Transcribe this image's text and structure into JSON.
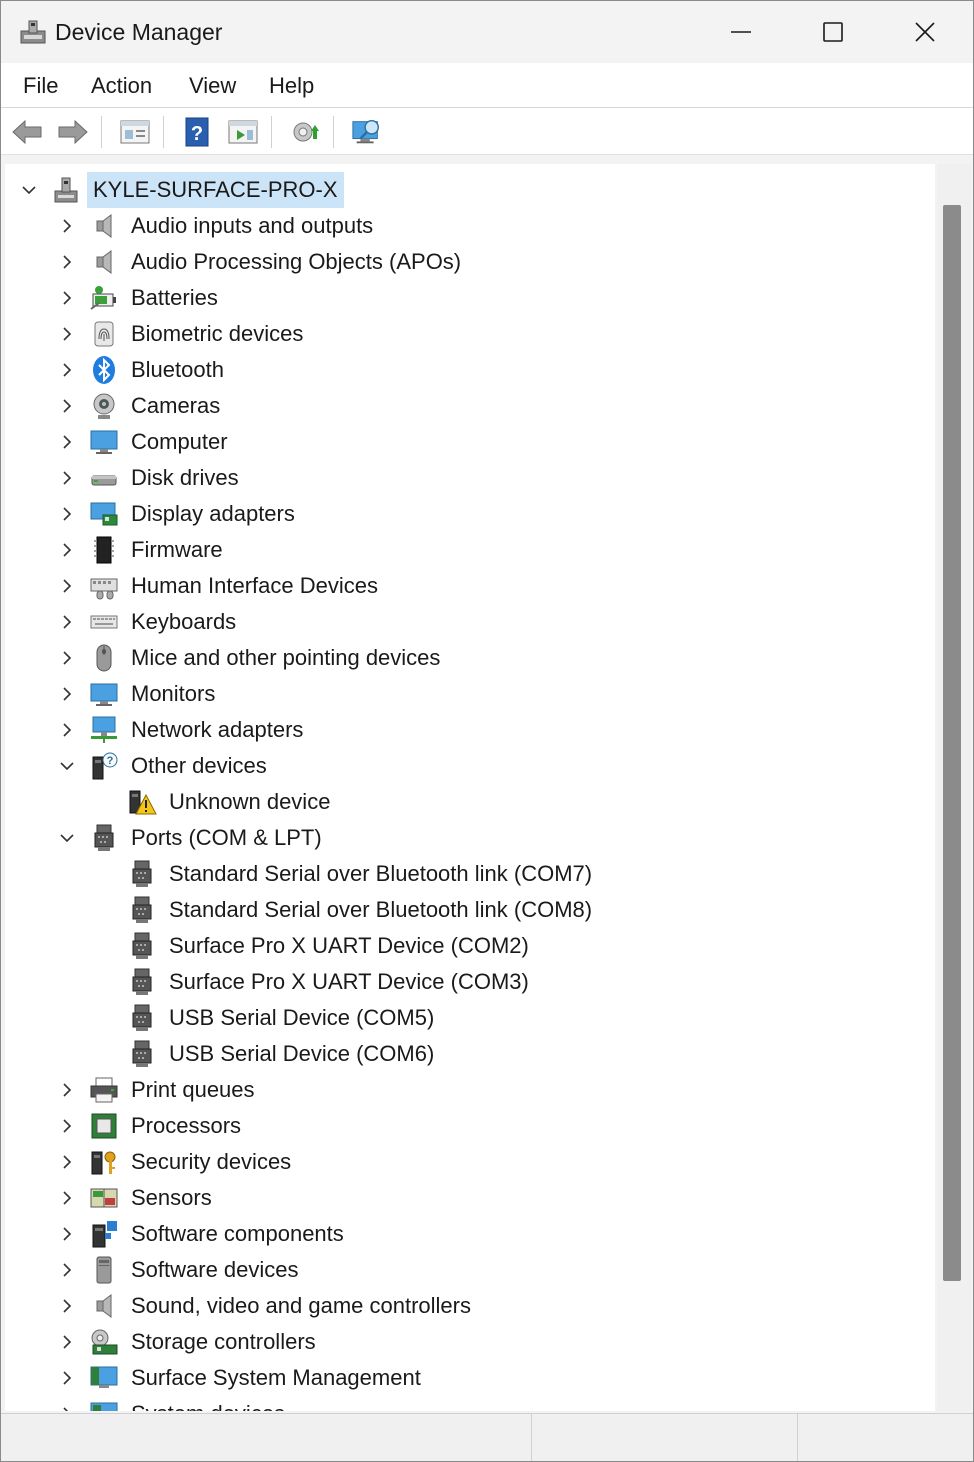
{
  "window": {
    "title": "Device Manager",
    "controls": [
      "minimize",
      "maximize",
      "close"
    ]
  },
  "menu": [
    "File",
    "Action",
    "View",
    "Help"
  ],
  "toolbar_icons": [
    "back-icon",
    "forward-icon",
    "properties-icon",
    "help-icon",
    "update-driver-icon",
    "add-hardware-icon",
    "scan-hardware-icon"
  ],
  "tree": {
    "root": {
      "label": "KYLE-SURFACE-PRO-X",
      "expanded": true
    },
    "categories": [
      {
        "label": "Audio inputs and outputs",
        "icon": "speaker-icon",
        "expanded": false
      },
      {
        "label": "Audio Processing Objects (APOs)",
        "icon": "speaker-icon",
        "expanded": false
      },
      {
        "label": "Batteries",
        "icon": "battery-icon",
        "expanded": false
      },
      {
        "label": "Biometric devices",
        "icon": "fingerprint-icon",
        "expanded": false
      },
      {
        "label": "Bluetooth",
        "icon": "bluetooth-icon",
        "expanded": false
      },
      {
        "label": "Cameras",
        "icon": "camera-icon",
        "expanded": false
      },
      {
        "label": "Computer",
        "icon": "computer-icon",
        "expanded": false
      },
      {
        "label": "Disk drives",
        "icon": "disk-icon",
        "expanded": false
      },
      {
        "label": "Display adapters",
        "icon": "display-adapter-icon",
        "expanded": false
      },
      {
        "label": "Firmware",
        "icon": "chip-icon",
        "expanded": false
      },
      {
        "label": "Human Interface Devices",
        "icon": "hid-icon",
        "expanded": false
      },
      {
        "label": "Keyboards",
        "icon": "keyboard-icon",
        "expanded": false
      },
      {
        "label": "Mice and other pointing devices",
        "icon": "mouse-icon",
        "expanded": false
      },
      {
        "label": "Monitors",
        "icon": "monitor-icon",
        "expanded": false
      },
      {
        "label": "Network adapters",
        "icon": "network-icon",
        "expanded": false
      },
      {
        "label": "Other devices",
        "icon": "unknown-device-icon",
        "expanded": true,
        "children": [
          {
            "label": "Unknown device",
            "icon": "warning-device-icon"
          }
        ]
      },
      {
        "label": "Ports (COM & LPT)",
        "icon": "port-icon",
        "expanded": true,
        "children": [
          {
            "label": "Standard Serial over Bluetooth link (COM7)",
            "icon": "port-icon"
          },
          {
            "label": "Standard Serial over Bluetooth link (COM8)",
            "icon": "port-icon"
          },
          {
            "label": "Surface Pro X UART Device (COM2)",
            "icon": "port-icon"
          },
          {
            "label": "Surface Pro X UART Device (COM3)",
            "icon": "port-icon"
          },
          {
            "label": "USB Serial Device (COM5)",
            "icon": "port-icon"
          },
          {
            "label": "USB Serial Device (COM6)",
            "icon": "port-icon"
          }
        ]
      },
      {
        "label": "Print queues",
        "icon": "printer-icon",
        "expanded": false
      },
      {
        "label": "Processors",
        "icon": "processor-icon",
        "expanded": false
      },
      {
        "label": "Security devices",
        "icon": "security-icon",
        "expanded": false
      },
      {
        "label": "Sensors",
        "icon": "sensor-icon",
        "expanded": false
      },
      {
        "label": "Software components",
        "icon": "software-component-icon",
        "expanded": false
      },
      {
        "label": "Software devices",
        "icon": "software-device-icon",
        "expanded": false
      },
      {
        "label": "Sound, video and game controllers",
        "icon": "speaker-icon",
        "expanded": false
      },
      {
        "label": "Storage controllers",
        "icon": "storage-icon",
        "expanded": false
      },
      {
        "label": "Surface System Management",
        "icon": "surface-icon",
        "expanded": false
      },
      {
        "label": "System devices",
        "icon": "system-icon",
        "expanded": false
      }
    ]
  },
  "colors": {
    "selection": "#cce4f7",
    "scrollbar_thumb": "#8b8b8b"
  }
}
